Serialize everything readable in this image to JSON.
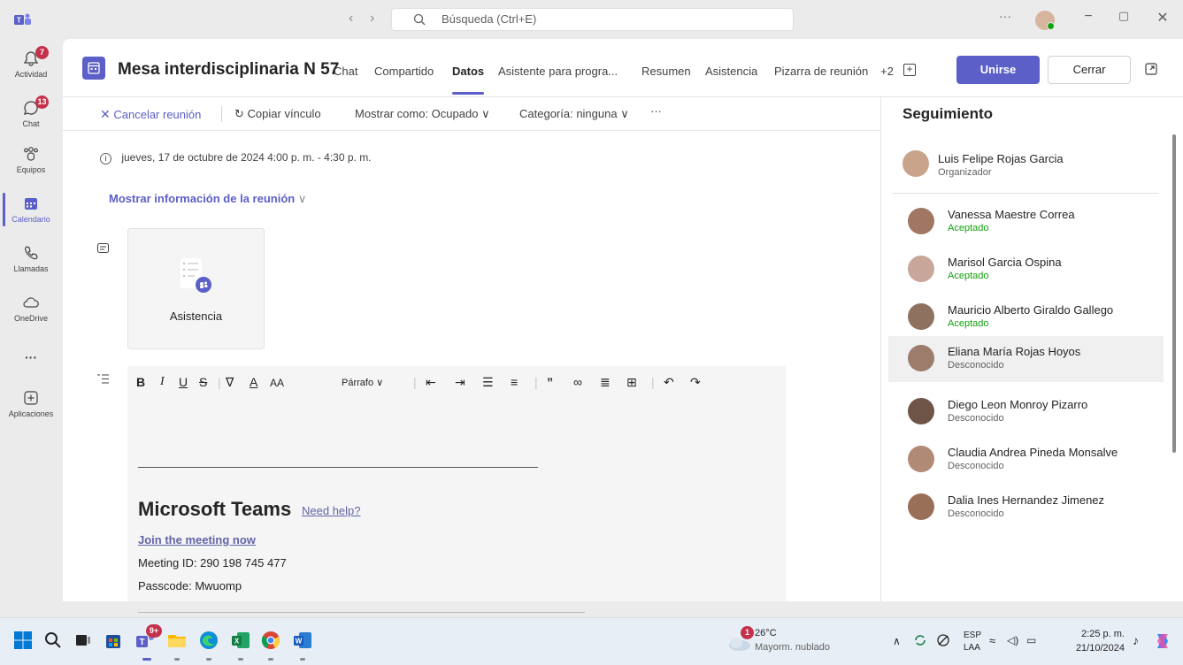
{
  "titlebar": {
    "search_placeholder": "Búsqueda (Ctrl+E)",
    "more_label": "···"
  },
  "rail": {
    "items": [
      {
        "label": "Actividad",
        "badge": "7"
      },
      {
        "label": "Chat",
        "badge": "13"
      },
      {
        "label": "Equipos"
      },
      {
        "label": "Calendario",
        "active": true
      },
      {
        "label": "Llamadas"
      },
      {
        "label": "OneDrive"
      },
      {
        "label": "···"
      },
      {
        "label": "Aplicaciones"
      }
    ]
  },
  "header": {
    "title": "Mesa interdisciplinaria N 57",
    "tabs": [
      {
        "label": "Chat"
      },
      {
        "label": "Compartido"
      },
      {
        "label": "Datos",
        "active": true
      },
      {
        "label": "Asistente para progra..."
      },
      {
        "label": "Resumen"
      },
      {
        "label": "Asistencia"
      },
      {
        "label": "Pizarra de reunión"
      },
      {
        "label": "+2"
      }
    ],
    "join_label": "Unirse",
    "close_label": "Cerrar"
  },
  "toolbar": {
    "cancel_label": "Cancelar reunión",
    "copy_link_label": "Copiar vínculo",
    "show_as_label": "Mostrar como: Ocupado",
    "category_label": "Categoría: ninguna",
    "more_label": "···"
  },
  "details": {
    "datetime": "jueves, 17 de octubre de 2024 4:00 p. m. - 4:30 p. m.",
    "show_info_label": "Mostrar información de la reunión",
    "card_label": "Asistencia"
  },
  "editor": {
    "paragraph_label": "Párrafo",
    "teams_title": "Microsoft Teams",
    "need_help": "Need help?",
    "join_now": "Join the meeting now",
    "meeting_id": "Meeting ID: 290 198 745 477",
    "passcode": "Passcode: Mwuomp"
  },
  "tracking": {
    "title": "Seguimiento",
    "organizer": {
      "name": "Luis Felipe Rojas Garcia",
      "status": "Organizador"
    },
    "attendees": [
      {
        "name": "Vanessa Maestre Correa",
        "status": "Aceptado"
      },
      {
        "name": "Marisol Garcia Ospina",
        "status": "Aceptado"
      },
      {
        "name": "Mauricio Alberto Giraldo Gallego",
        "status": "Aceptado"
      },
      {
        "name": "Eliana María Rojas Hoyos",
        "status": "Desconocido"
      },
      {
        "name": "Diego Leon Monroy Pizarro",
        "status": "Desconocido"
      },
      {
        "name": "Claudia Andrea Pineda Monsalve",
        "status": "Desconocido"
      },
      {
        "name": "Dalia Ines Hernandez Jimenez",
        "status": "Desconocido"
      }
    ]
  },
  "taskbar": {
    "teams_badge": "9+",
    "weather_badge": "1",
    "temperature": "26°C",
    "weather_desc": "Mayorm. nublado",
    "lang_top": "ESP",
    "lang_bottom": "LAA",
    "time": "2:25 p. m.",
    "date": "21/10/2024"
  },
  "colors": {
    "accent": "#5b5fc7",
    "accepted": "#13a10e",
    "badge": "#c4314b"
  }
}
